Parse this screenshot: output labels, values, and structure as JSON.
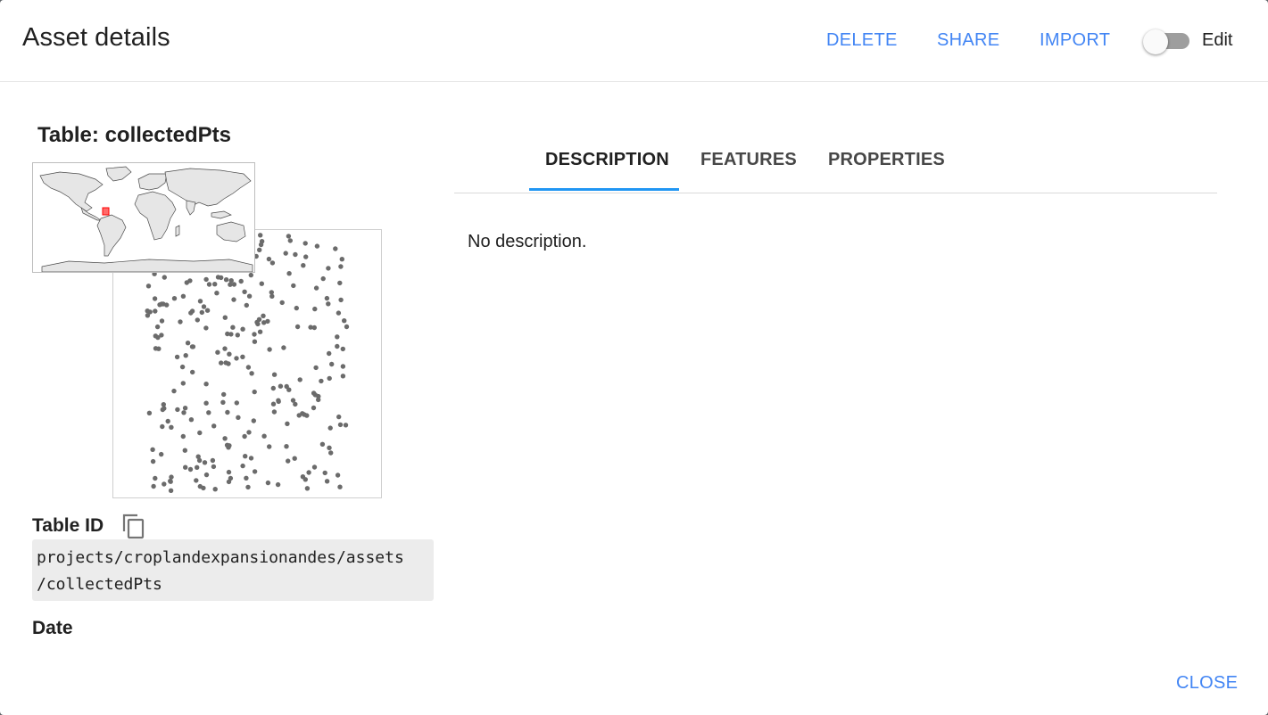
{
  "dialog": {
    "title": "Asset details",
    "actions": [
      "DELETE",
      "SHARE",
      "IMPORT"
    ],
    "edit_toggle": {
      "label": "Edit",
      "on": false
    },
    "close_label": "CLOSE"
  },
  "asset": {
    "table_title": "Table: collectedPts",
    "table_id_label": "Table ID",
    "table_id_line1": "projects/croplandexpansionandes/assets",
    "table_id_line2": "/collectedPts",
    "date_label": "Date"
  },
  "tabs": [
    {
      "label": "DESCRIPTION",
      "active": true
    },
    {
      "label": "FEATURES",
      "active": false
    },
    {
      "label": "PROPERTIES",
      "active": false
    }
  ],
  "description_text": "No description.",
  "colors": {
    "accent": "#4285f4",
    "tab_ink": "#2196f3",
    "point": "#6b6b6b",
    "extent_marker": "#ff0000"
  }
}
